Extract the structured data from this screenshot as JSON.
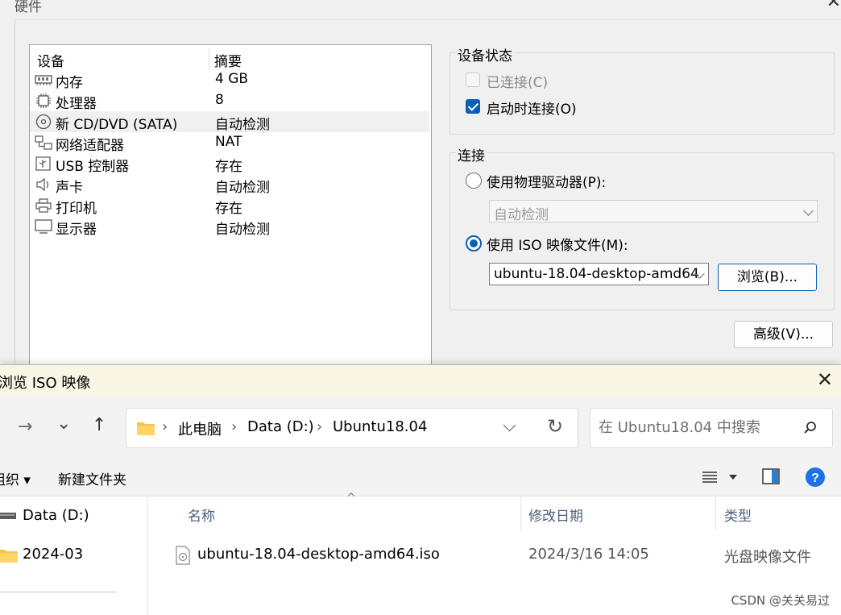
{
  "hw_dialog": {
    "title": "硬件",
    "close_glyph": "✕",
    "device_list": {
      "headers": [
        "设备",
        "摘要"
      ],
      "devices": [
        {
          "name": "内存",
          "summary": "4 GB",
          "icon": "memory-icon"
        },
        {
          "name": "处理器",
          "summary": "8",
          "icon": "cpu-icon"
        },
        {
          "name": "新 CD/DVD (SATA)",
          "summary": "自动检测",
          "icon": "cd-dvd-icon",
          "selected": true
        },
        {
          "name": "网络适配器",
          "summary": "NAT",
          "icon": "network-adapter-icon"
        },
        {
          "name": "USB 控制器",
          "summary": "存在",
          "icon": "usb-icon"
        },
        {
          "name": "声卡",
          "summary": "自动检测",
          "icon": "speaker-icon"
        },
        {
          "name": "打印机",
          "summary": "存在",
          "icon": "printer-icon"
        },
        {
          "name": "显示器",
          "summary": "自动检测",
          "icon": "monitor-icon"
        }
      ]
    },
    "device_status": {
      "legend": "设备状态",
      "connected": {
        "label": "已连接(C)",
        "checked": false,
        "disabled": true
      },
      "connect_at_power_on": {
        "label": "启动时连接(O)",
        "checked": true
      }
    },
    "connection": {
      "legend": "连接",
      "physical_drive": {
        "label": "使用物理驱动器(P):",
        "selected": false,
        "value": "自动检测"
      },
      "iso_image": {
        "label": "使用 ISO 映像文件(M):",
        "selected": true,
        "value": "ubuntu-18.04-desktop-amd64"
      },
      "browse_button": "浏览(B)...",
      "advanced_button": "高级(V)..."
    }
  },
  "browse_dialog": {
    "title": "浏览 ISO 映像",
    "close_glyph": "✕",
    "nav": {
      "forward": "→",
      "recent": "⌄",
      "up": "↑",
      "refresh": "↻"
    },
    "breadcrumb": [
      "此电脑",
      "Data (D:)",
      "Ubuntu18.04"
    ],
    "search_placeholder": "在 Ubuntu18.04 中搜索",
    "command_bar": {
      "organize": "组织 ▾",
      "new_folder": "新建文件夹"
    },
    "nav_pane": [
      {
        "label": "Data (D:)",
        "icon": "drive-icon"
      },
      {
        "label": "2024-03",
        "icon": "folder-icon"
      }
    ],
    "columns": [
      "名称",
      "修改日期",
      "类型"
    ],
    "files": [
      {
        "name": "ubuntu-18.04-desktop-amd64.iso",
        "modified": "2024/3/16 14:05",
        "type": "光盘映像文件"
      }
    ]
  },
  "watermark": "CSDN @关关易过",
  "colors": {
    "accent": "#0a5fb4",
    "title_bar": "#f9f6e6",
    "help": "#1a73e8"
  }
}
